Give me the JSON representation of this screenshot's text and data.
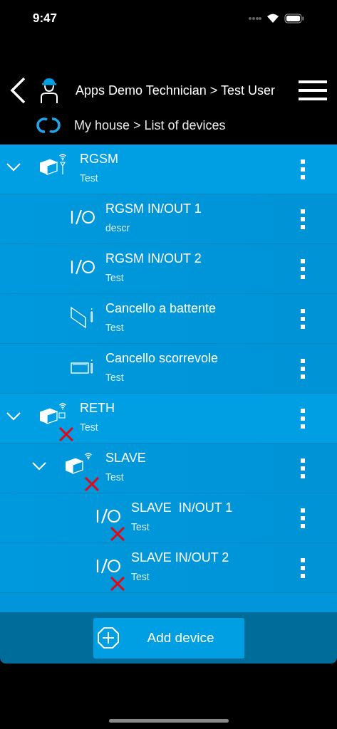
{
  "status_bar": {
    "time": "9:47"
  },
  "header": {
    "title": "Apps Demo Technician > Test User",
    "breadcrumb": "My house > List of devices"
  },
  "devices": [
    {
      "kind": "gsm-hub",
      "name": "RGSM",
      "description": "Test",
      "expanded": true,
      "offline": false,
      "children": [
        {
          "kind": "io",
          "name": "RGSM IN/OUT 1",
          "description": "descr",
          "offline": false
        },
        {
          "kind": "io",
          "name": "RGSM IN/OUT 2",
          "description": "Test",
          "offline": false
        },
        {
          "kind": "swing-gate",
          "name": "Cancello a battente",
          "description": "Test",
          "offline": false
        },
        {
          "kind": "sliding-gate",
          "name": "Cancello scorrevole",
          "description": "Test",
          "offline": false
        }
      ]
    },
    {
      "kind": "eth-hub",
      "name": "RETH",
      "description": "Test",
      "expanded": true,
      "offline": true,
      "children": [
        {
          "kind": "slave",
          "name": "SLAVE",
          "description": "Test",
          "expanded": true,
          "offline": true,
          "children": [
            {
              "kind": "io",
              "name": "SLAVE  IN/OUT 1",
              "description": "Test",
              "offline": true
            },
            {
              "kind": "io",
              "name": "SLAVE IN/OUT 2",
              "description": "Test",
              "offline": true
            }
          ]
        }
      ]
    }
  ],
  "footer": {
    "add_button": "Add device"
  }
}
